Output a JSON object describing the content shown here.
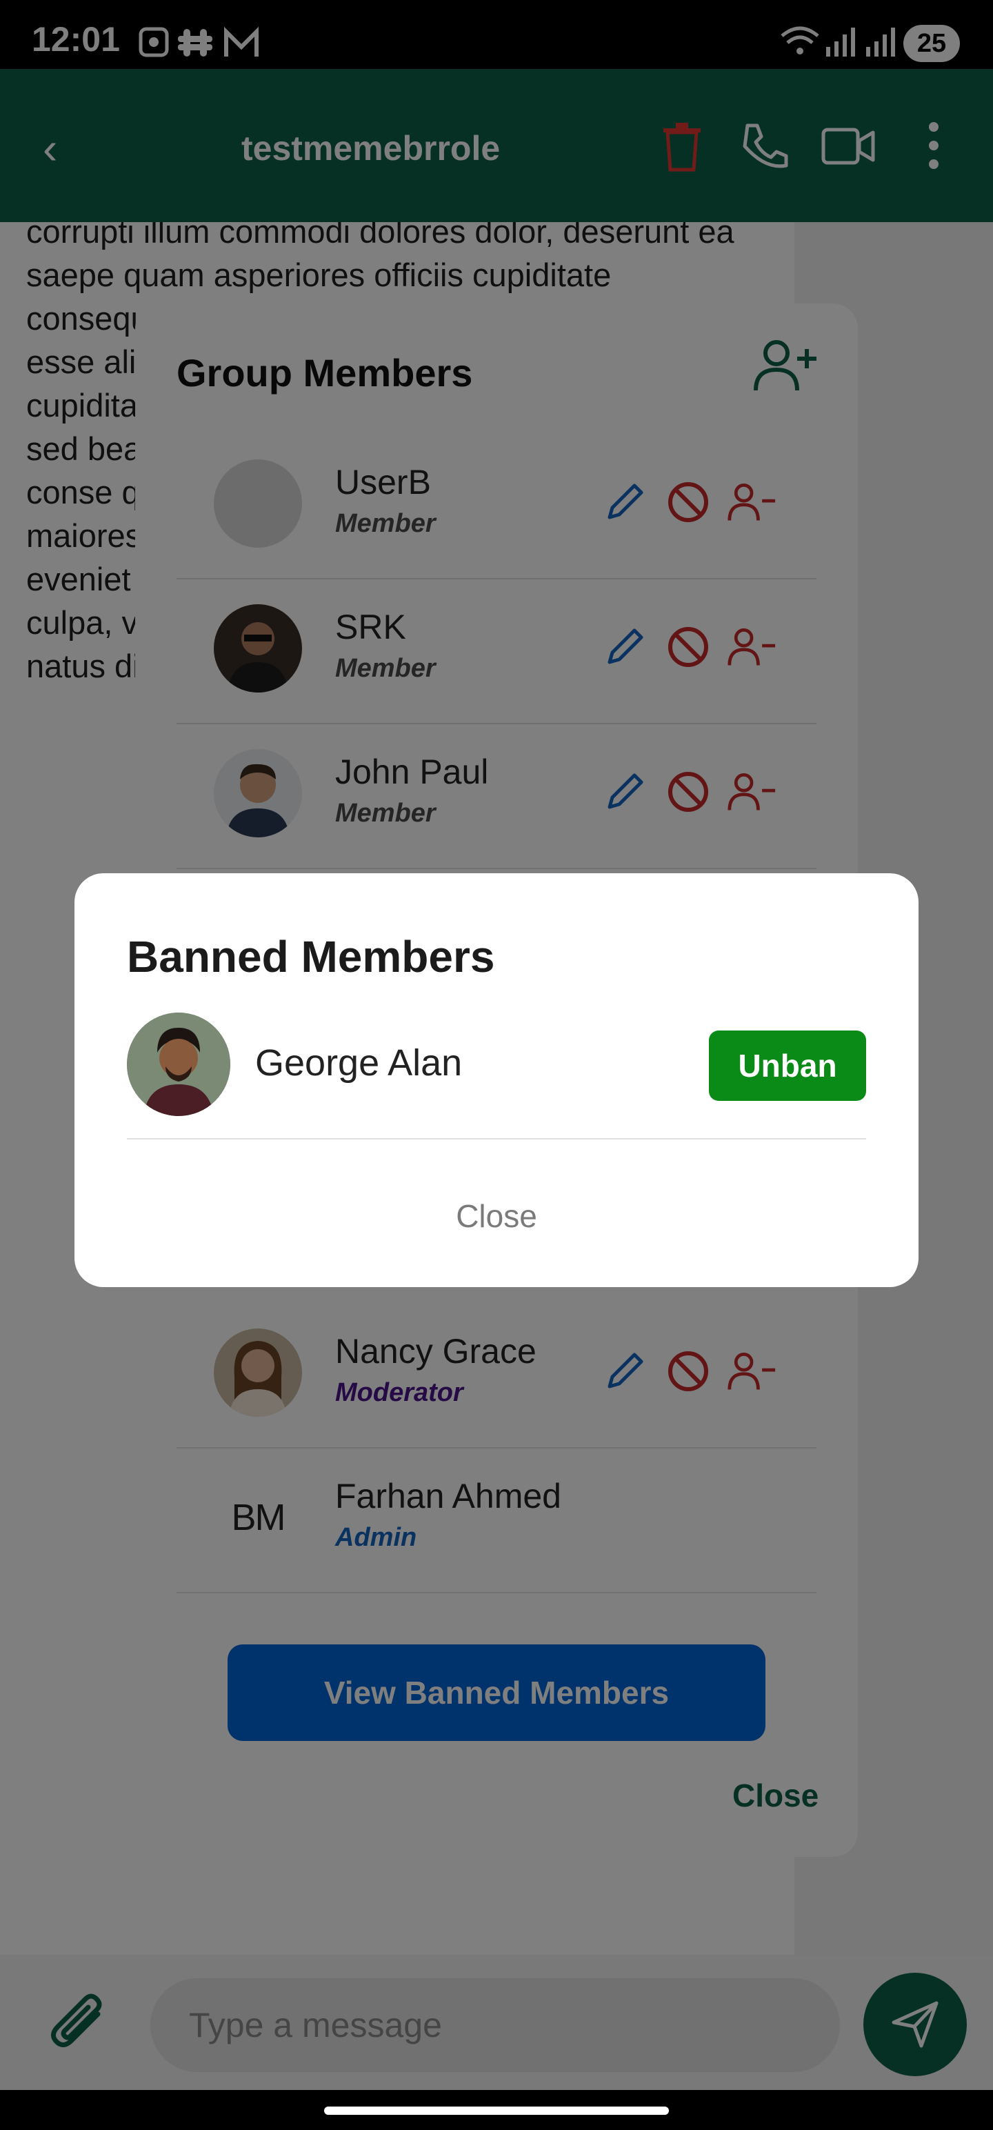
{
  "status_bar": {
    "time": "12:01",
    "battery": "25"
  },
  "header": {
    "title": "testmemebrrole"
  },
  "chat": {
    "message_text": "corrupti illum commodi dolores dolor, deserunt ea saepe quam asperiores officiis cupiditate consequatur veniam! Facere officiis ut explicabo esse alias blanditiis sit ipsa excepturi accusamus cupiditate Minus molestiae exercitationem impedit sed beatae ut, maxime vero minus esse cum volup conse quam volup Quis illo repel alicu blan Quod s maiores optio c volupta pariatu repelle in com eveniet dolore nihil ne reicien cumqu consec porro culpa, voluptatem dolorum iusto eum qui maxime natus distinctio! Eveniet rem"
  },
  "composer": {
    "placeholder": "Type a message"
  },
  "group_members": {
    "title": "Group Members",
    "members": [
      {
        "name": "UserB",
        "role": "Member"
      },
      {
        "name": "SRK",
        "role": "Member"
      },
      {
        "name": "John Paul",
        "role": "Member"
      },
      {
        "name": "Nancy Grace",
        "role": "Moderator"
      },
      {
        "name": "Farhan Ahmed",
        "role": "Admin",
        "avatar_text": "BM"
      }
    ],
    "view_banned_label": "View Banned Members",
    "close_label": "Close"
  },
  "banned_members": {
    "title": "Banned Members",
    "items": [
      {
        "name": "George Alan",
        "action_label": "Unban"
      }
    ],
    "close_label": "Close"
  },
  "colors": {
    "header_green": "#0c6148",
    "unban_green": "#0a8a17",
    "view_banned_blue": "#0066d6",
    "edit_blue": "#1565c0",
    "danger_red": "#c62828",
    "moderator_purple": "#4a148c",
    "admin_blue": "#1565c0"
  }
}
